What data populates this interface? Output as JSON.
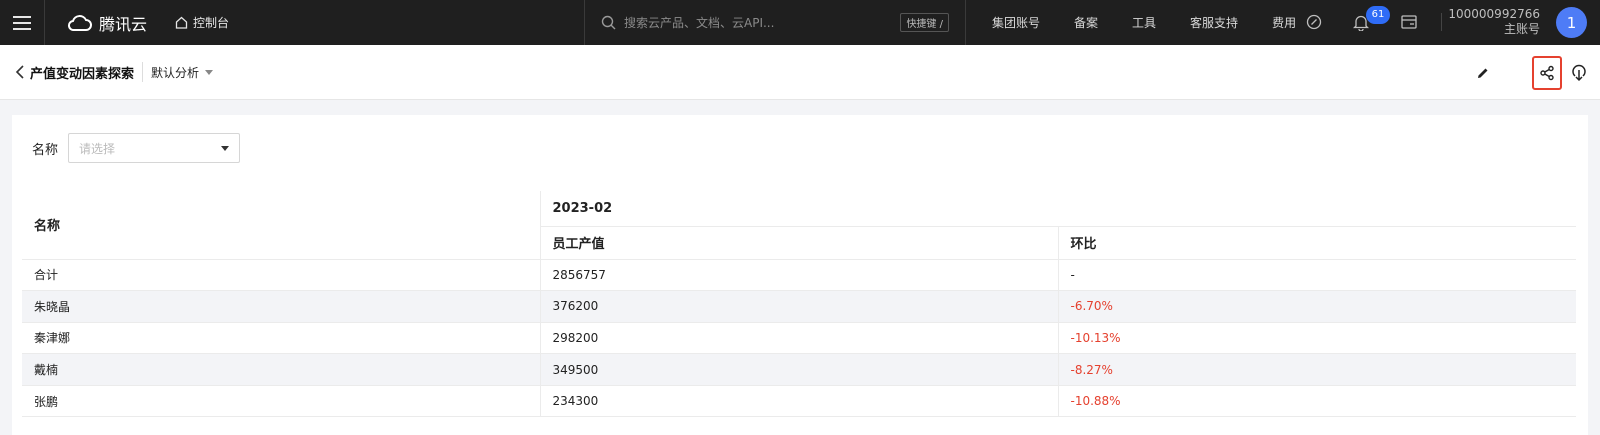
{
  "topbar": {
    "brand": "腾讯云",
    "console": "控制台",
    "search_placeholder": "搜索云产品、文档、云API...",
    "shortcut": "快捷键 /",
    "nav": [
      "集团账号",
      "备案",
      "工具",
      "客服支持",
      "费用"
    ],
    "notifications": "61",
    "account_id": "100000992766",
    "account_role": "主账号",
    "avatar": "1"
  },
  "page": {
    "title": "产值变动因素探索",
    "analysis": "默认分析"
  },
  "filter": {
    "label": "名称",
    "placeholder": "请选择"
  },
  "table": {
    "name_header": "名称",
    "period": "2023-02",
    "col_value": "员工产值",
    "col_change": "环比",
    "rows": [
      {
        "name": "合计",
        "value": "2856757",
        "change": "-"
      },
      {
        "name": "朱晓晶",
        "value": "376200",
        "change": "-6.70%"
      },
      {
        "name": "秦津娜",
        "value": "298200",
        "change": "-10.13%"
      },
      {
        "name": "戴楠",
        "value": "349500",
        "change": "-8.27%"
      },
      {
        "name": "张鹏",
        "value": "234300",
        "change": "-10.88%"
      }
    ]
  },
  "colors": {
    "topbar_bg": "#1f1f1f",
    "accent_blue": "#2f6cf6",
    "negative_red": "#e5412f",
    "highlight_border": "#e5412f"
  }
}
